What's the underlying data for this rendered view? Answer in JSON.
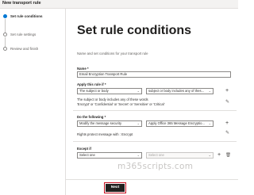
{
  "window": {
    "title": "New transport rule"
  },
  "steps": [
    {
      "label": "Set rule conditions"
    },
    {
      "label": "Set rule settings"
    },
    {
      "label": "Review and finish"
    }
  ],
  "main": {
    "heading": "Set rule conditions",
    "description": "Name and set conditions for your transport rule",
    "name": {
      "label": "Name *",
      "value": "Email Encryption Transport Rule"
    },
    "apply": {
      "label": "Apply this rule if *",
      "select1": "The subject or body",
      "select2": "subject or body includes any of thes...",
      "summary_line1": "The subject or body includes any of these words",
      "summary_line2": "'Encrypt' or 'Confidential' or 'Secret' or 'Sensitive' or 'Critical'"
    },
    "do": {
      "label": "Do the following *",
      "select1": "Modify the message security",
      "select2": "Apply Office 365 Message Encryptio...",
      "summary": "Rights protect message with : Encrypt"
    },
    "except": {
      "label": "Except if",
      "select1": "Select one",
      "select2": "Select one"
    }
  },
  "watermark": "m365scripts.com",
  "footer": {
    "next_label": "Next"
  }
}
